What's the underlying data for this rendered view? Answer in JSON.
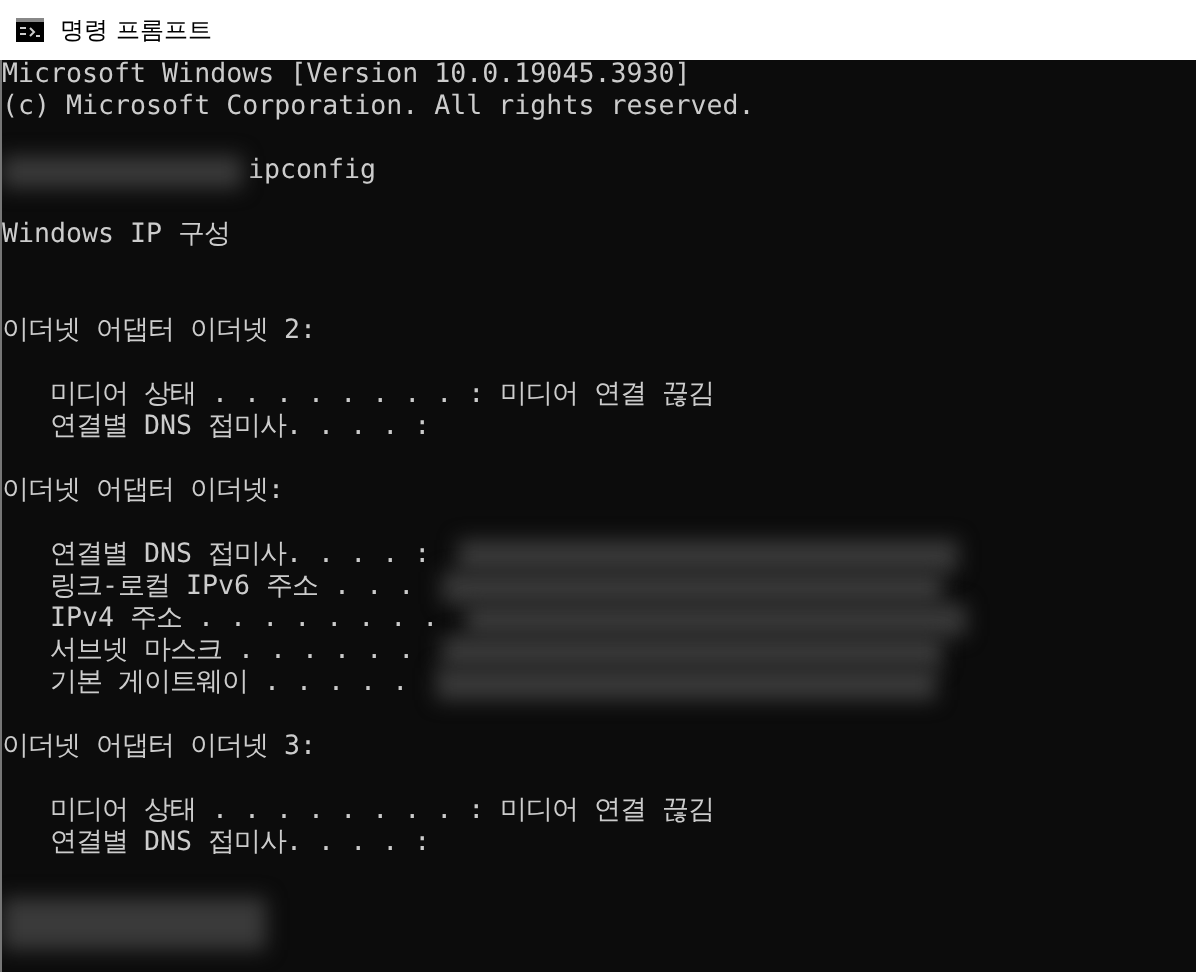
{
  "window": {
    "title": "명령 프롬프트"
  },
  "lines": [
    {
      "kind": "text",
      "text": "Microsoft Windows [Version 10.0.19045.3930]"
    },
    {
      "kind": "text",
      "text": "(c) Microsoft Corporation. All rights reserved."
    },
    {
      "kind": "blank"
    },
    {
      "kind": "command",
      "text": "ipconfig"
    },
    {
      "kind": "blank"
    },
    {
      "kind": "text",
      "text": "Windows IP 구성"
    },
    {
      "kind": "blank"
    },
    {
      "kind": "blank"
    },
    {
      "kind": "text",
      "text": "이더넷 어댑터 이더넷 2:"
    },
    {
      "kind": "blank"
    },
    {
      "kind": "text",
      "text": "   미디어 상태 . . . . . . . . : 미디어 연결 끊김"
    },
    {
      "kind": "text",
      "text": "   연결별 DNS 접미사. . . . :"
    },
    {
      "kind": "blank"
    },
    {
      "kind": "text",
      "text": "이더넷 어댑터 이더넷:"
    },
    {
      "kind": "blank"
    },
    {
      "kind": "hidden_value",
      "text": "   연결별 DNS 접미사. . . . :"
    },
    {
      "kind": "hidden_value",
      "text": "   링크-로컬 IPv6 주소 . . ."
    },
    {
      "kind": "hidden_value",
      "text": "   IPv4 주소 . . . . . . . ."
    },
    {
      "kind": "hidden_value",
      "text": "   서브넷 마스크 . . . . . ."
    },
    {
      "kind": "hidden_value",
      "text": "   기본 게이트웨이 . . . . ."
    },
    {
      "kind": "blank"
    },
    {
      "kind": "text",
      "text": "이더넷 어댑터 이더넷 3:"
    },
    {
      "kind": "blank"
    },
    {
      "kind": "text",
      "text": "   미디어 상태 . . . . . . . . : 미디어 연결 끊김"
    },
    {
      "kind": "text",
      "text": "   연결별 DNS 접미사. . . . :"
    },
    {
      "kind": "blank"
    },
    {
      "kind": "prompt"
    }
  ]
}
